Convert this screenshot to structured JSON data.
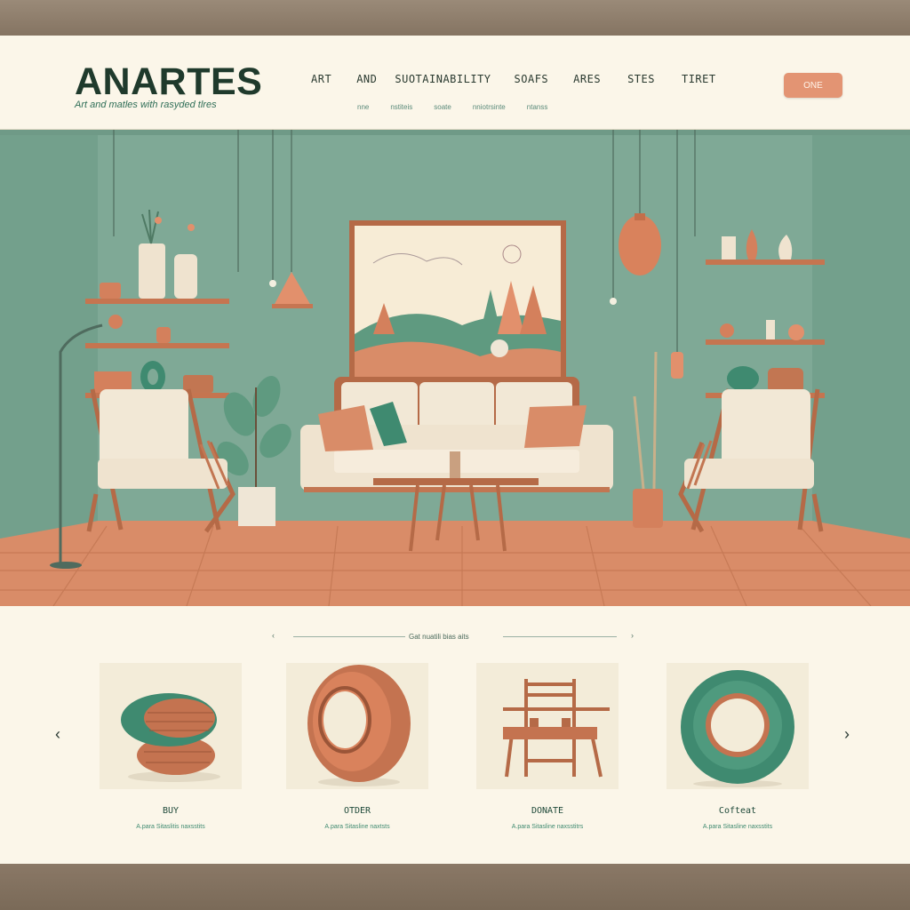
{
  "brand": {
    "name": "ANARTES",
    "tagline": "Art and matles with rasyded tlres"
  },
  "nav": {
    "items": [
      "ART",
      "AND",
      "SUOTAINABILITY",
      "SOAFS",
      "ARES",
      "STES",
      "TIRET"
    ],
    "subitems": [
      "nne",
      "nstiteis",
      "soate",
      "nniotrsinte",
      "ntanss"
    ],
    "cta_label": "ONE"
  },
  "section": {
    "title": "Gat nuatili bias aits",
    "prev_small": "‹",
    "next_small": "›"
  },
  "products": [
    {
      "label": "BUY",
      "sub": "A.para Sitaslitis naxsstits",
      "image": "stacked-tire-ottoman"
    },
    {
      "label": "OTDER",
      "sub": "A.para Sitasline naxtsts",
      "image": "terracotta-tire"
    },
    {
      "label": "DONATE",
      "sub": "A.para Sitasline naxsstitrs",
      "image": "tire-chair"
    },
    {
      "label": "Cofteat",
      "sub": "A.para Sitasline naxsstits",
      "image": "green-tire"
    }
  ],
  "carousel": {
    "prev": "‹",
    "next": "›"
  },
  "colors": {
    "wall": "#7ea896",
    "floor": "#d98c68",
    "accent": "#e39473",
    "cream": "#fbf6e9",
    "text_dark": "#1f3a2c"
  },
  "icons": [
    "chevron-left-icon",
    "chevron-right-icon"
  ]
}
